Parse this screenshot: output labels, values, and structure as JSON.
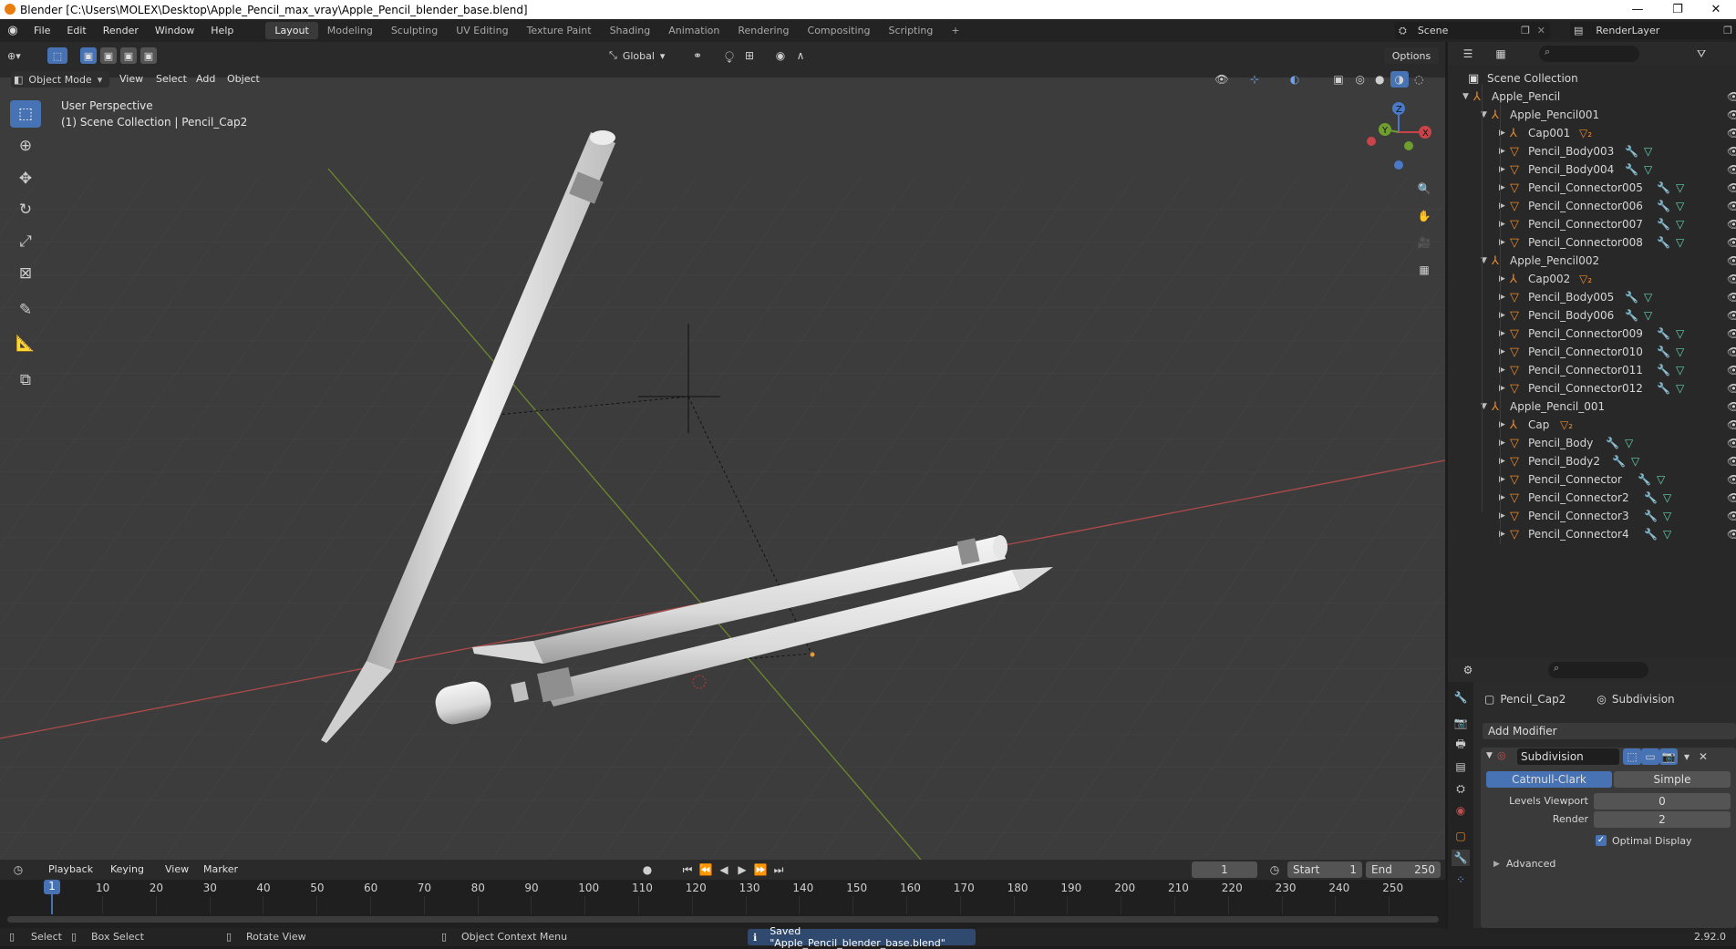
{
  "window": {
    "title": "Blender [C:\\Users\\MOLEX\\Desktop\\Apple_Pencil_max_vray\\Apple_Pencil_blender_base.blend]"
  },
  "menu": [
    "File",
    "Edit",
    "Render",
    "Window",
    "Help"
  ],
  "workspaces": [
    "Layout",
    "Modeling",
    "Sculpting",
    "UV Editing",
    "Texture Paint",
    "Shading",
    "Animation",
    "Rendering",
    "Compositing",
    "Scripting"
  ],
  "top_right": {
    "scene": "Scene",
    "view_layer": "RenderLayer"
  },
  "viewport": {
    "mode": "Object Mode",
    "menus": [
      "View",
      "Select",
      "Add",
      "Object"
    ],
    "orientation": "Global",
    "options": "Options",
    "overlay_title": "User Perspective",
    "overlay_sub": "(1) Scene Collection | Pencil_Cap2",
    "gizmo": {
      "z": "Z",
      "y": "Y",
      "x": "X"
    }
  },
  "outliner": {
    "root": "Scene Collection",
    "rows": [
      {
        "label": "Apple_Pencil",
        "depth": 0,
        "kind": "empty",
        "open": true
      },
      {
        "label": "Apple_Pencil001",
        "depth": 1,
        "kind": "empty",
        "open": true
      },
      {
        "label": "Cap001",
        "depth": 2,
        "kind": "empty",
        "extra": "▽₂"
      },
      {
        "label": "Pencil_Body003",
        "depth": 2,
        "kind": "mesh",
        "mods": true
      },
      {
        "label": "Pencil_Body004",
        "depth": 2,
        "kind": "mesh",
        "mods": true
      },
      {
        "label": "Pencil_Connector005",
        "depth": 2,
        "kind": "mesh",
        "mods": true
      },
      {
        "label": "Pencil_Connector006",
        "depth": 2,
        "kind": "mesh",
        "mods": true
      },
      {
        "label": "Pencil_Connector007",
        "depth": 2,
        "kind": "mesh",
        "mods": true
      },
      {
        "label": "Pencil_Connector008",
        "depth": 2,
        "kind": "mesh",
        "mods": true
      },
      {
        "label": "Apple_Pencil002",
        "depth": 1,
        "kind": "empty",
        "open": true
      },
      {
        "label": "Cap002",
        "depth": 2,
        "kind": "empty",
        "extra": "▽₂"
      },
      {
        "label": "Pencil_Body005",
        "depth": 2,
        "kind": "mesh",
        "mods": true
      },
      {
        "label": "Pencil_Body006",
        "depth": 2,
        "kind": "mesh",
        "mods": true
      },
      {
        "label": "Pencil_Connector009",
        "depth": 2,
        "kind": "mesh",
        "mods": true
      },
      {
        "label": "Pencil_Connector010",
        "depth": 2,
        "kind": "mesh",
        "mods": true
      },
      {
        "label": "Pencil_Connector011",
        "depth": 2,
        "kind": "mesh",
        "mods": true
      },
      {
        "label": "Pencil_Connector012",
        "depth": 2,
        "kind": "mesh",
        "mods": true
      },
      {
        "label": "Apple_Pencil_001",
        "depth": 1,
        "kind": "empty",
        "open": true
      },
      {
        "label": "Cap",
        "depth": 2,
        "kind": "empty",
        "extra": "▽₂"
      },
      {
        "label": "Pencil_Body",
        "depth": 2,
        "kind": "mesh",
        "mods": true
      },
      {
        "label": "Pencil_Body2",
        "depth": 2,
        "kind": "mesh",
        "mods": true
      },
      {
        "label": "Pencil_Connector",
        "depth": 2,
        "kind": "mesh",
        "mods": true
      },
      {
        "label": "Pencil_Connector2",
        "depth": 2,
        "kind": "mesh",
        "mods": true
      },
      {
        "label": "Pencil_Connector3",
        "depth": 2,
        "kind": "mesh",
        "mods": true
      },
      {
        "label": "Pencil_Connector4",
        "depth": 2,
        "kind": "mesh",
        "mods": true
      }
    ]
  },
  "properties": {
    "object": "Pencil_Cap2",
    "modifier_breadcrumb": "Subdivision",
    "add_modifier": "Add Modifier",
    "modifier_name": "Subdivision",
    "algorithms": [
      "Catmull-Clark",
      "Simple"
    ],
    "levels_viewport_label": "Levels Viewport",
    "levels_viewport": "0",
    "render_label": "Render",
    "render_value": "2",
    "optimal_display": "Optimal Display",
    "advanced": "Advanced"
  },
  "timeline": {
    "menus": [
      "Playback",
      "Keying",
      "View",
      "Marker"
    ],
    "current_frame": "1",
    "start_label": "Start",
    "start": "1",
    "end_label": "End",
    "end": "250",
    "ruler": [
      "10",
      "20",
      "30",
      "40",
      "50",
      "60",
      "70",
      "80",
      "90",
      "100",
      "110",
      "120",
      "130",
      "140",
      "150",
      "160",
      "170",
      "180",
      "190",
      "200",
      "210",
      "220",
      "230",
      "240",
      "250"
    ],
    "cursor_label": "1"
  },
  "status": {
    "select": "Select",
    "box_select": "Box Select",
    "rotate_view": "Rotate View",
    "context_menu": "Object Context Menu",
    "message": "Saved \"Apple_Pencil_blender_base.blend\"",
    "version": "2.92.0"
  }
}
